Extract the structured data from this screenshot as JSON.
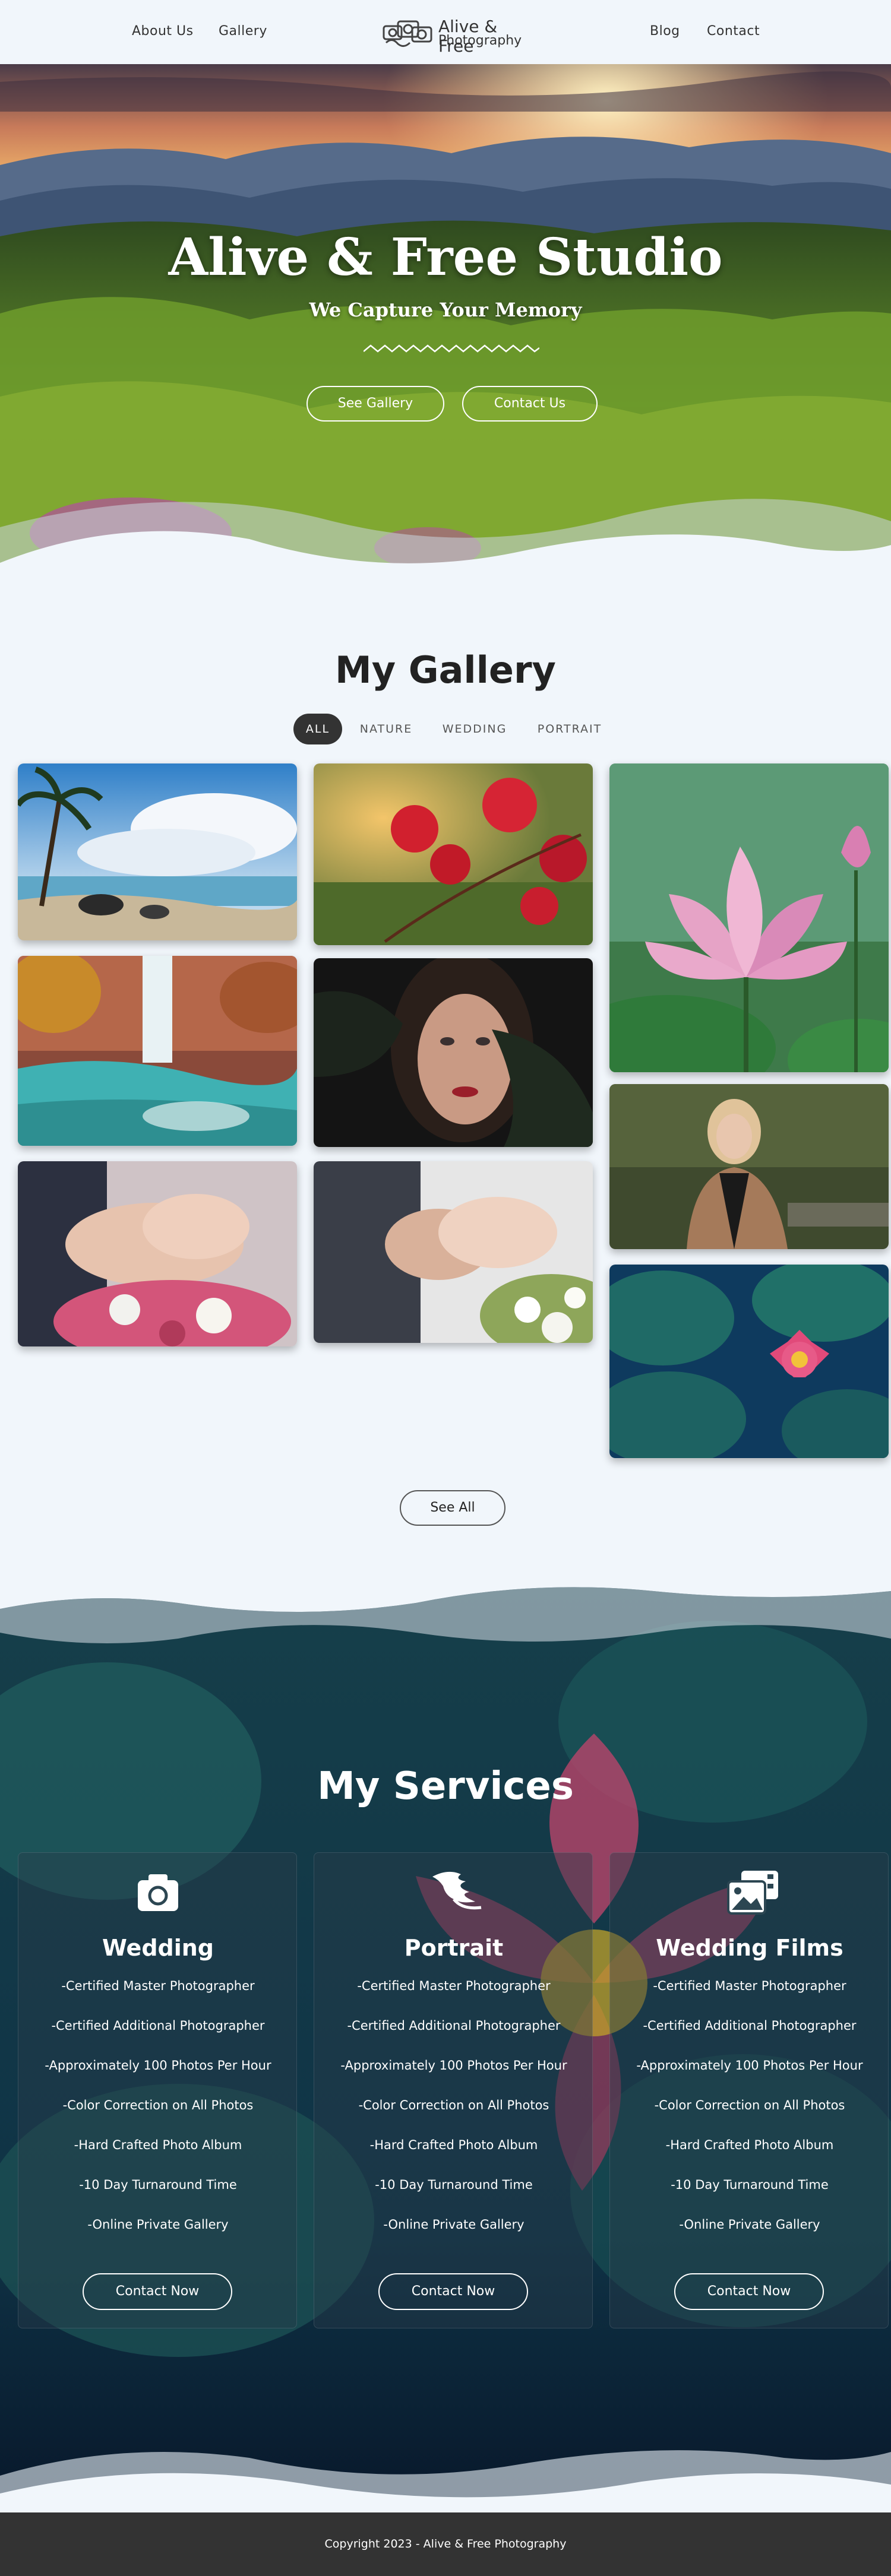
{
  "nav": {
    "left_links": [
      "About Us",
      "Gallery"
    ],
    "right_links": [
      "Blog",
      "Contact"
    ],
    "logo_line1": "Alive & Free",
    "logo_line2": "Photography"
  },
  "hero": {
    "title": "Alive & Free Studio",
    "subtitle": "We Capture Your Memory",
    "buttons": [
      "See Gallery",
      "Contact Us"
    ]
  },
  "gallery": {
    "title": "My Gallery",
    "filters": [
      "ALL",
      "NATURE",
      "WEDDING",
      "PORTRAIT"
    ],
    "active_filter": "ALL",
    "see_all": "See All"
  },
  "services": {
    "title": "My Services",
    "cards": [
      {
        "icon": "camera-icon",
        "title": "Wedding",
        "features": [
          "-Certified Master Photographer",
          "-Certified Additional Photographer",
          "-Approximately 100 Photos Per Hour",
          "-Color Correction on All Photos",
          "-Hard Crafted Photo Album",
          "-10 Day Turnaround Time",
          "-Online Private Gallery"
        ],
        "button": "Contact Now"
      },
      {
        "icon": "feather-hand-icon",
        "title": "Portrait",
        "features": [
          "-Certified Master Photographer",
          "-Certified Additional Photographer",
          "-Approximately 100 Photos Per Hour",
          "-Color Correction on All Photos",
          "-Hard Crafted Photo Album",
          "-10 Day Turnaround Time",
          "-Online Private Gallery"
        ],
        "button": "Contact Now"
      },
      {
        "icon": "photo-film-icon",
        "title": "Wedding Films",
        "features": [
          "-Certified Master Photographer",
          "-Certified Additional Photographer",
          "-Approximately 100 Photos Per Hour",
          "-Color Correction on All Photos",
          "-Hard Crafted Photo Album",
          "-10 Day Turnaround Time",
          "-Online Private Gallery"
        ],
        "button": "Contact Now"
      }
    ]
  },
  "footer": {
    "text": "Copyright 2023 - Alive & Free Photography"
  },
  "colors": {
    "background": "#f1f6fb",
    "dark": "#333333",
    "footer": "#333333"
  }
}
